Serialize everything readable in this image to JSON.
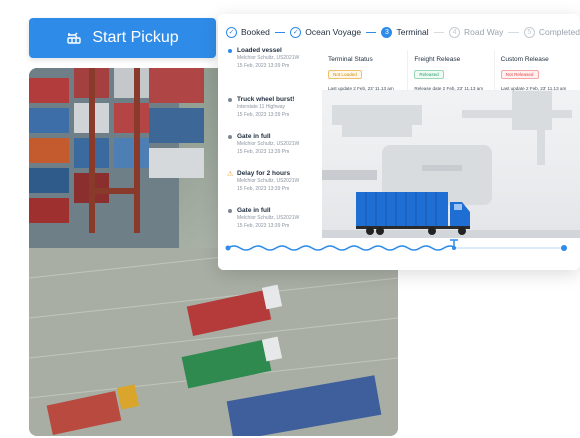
{
  "pickup_button": {
    "label": "Start Pickup",
    "icon": "truck-arrow-icon"
  },
  "tracker": {
    "steps": [
      {
        "label": "Booked",
        "state": "done",
        "mark": "✓"
      },
      {
        "label": "Ocean Voyage",
        "state": "done",
        "mark": "✓"
      },
      {
        "label": "Terminal",
        "state": "current",
        "mark": "3"
      },
      {
        "label": "Road Way",
        "state": "todo",
        "mark": "4"
      },
      {
        "label": "Completed",
        "state": "todo",
        "mark": "5"
      }
    ],
    "events": [
      {
        "title": "Loaded vessel",
        "place": "Melchior Schultz, US2021W",
        "time": "15 Feb, 2023 13:39 Pm",
        "kind": "blue"
      },
      {
        "title": "Truck wheel burst!",
        "place": "Interstate 11 Highway",
        "time": "15 Feb, 2023 13:39 Pm",
        "kind": "grey"
      },
      {
        "title": "Gate in full",
        "place": "Melchior Schultz, US2021W",
        "time": "15 Feb, 2023 13:39 Pm",
        "kind": "grey"
      },
      {
        "title": "Delay for 2 hours",
        "place": "Melchior Schultz, US2021W",
        "time": "15 Feb, 2023 13:39 Pm",
        "kind": "warn"
      },
      {
        "title": "Gate in full",
        "place": "Melchior Schultz, US2021W",
        "time": "15 Feb, 2023 13:39 Pm",
        "kind": "grey"
      }
    ],
    "statuses": [
      {
        "heading": "Terminal Status",
        "badge": "Not Loaded",
        "tone": "amber",
        "update": "Last update 2 Feb, 23' 11.13 am"
      },
      {
        "heading": "Freight Release",
        "badge": "Released",
        "tone": "green",
        "update": "Release date 2 Feb, 23' 11.13 am"
      },
      {
        "heading": "Custom Release",
        "badge": "Not Released",
        "tone": "red",
        "update": "Last update 2 Feb, 23' 11.13 am"
      }
    ]
  },
  "colors": {
    "accent": "#2f8be8",
    "truck_blue": "#1f6ed4"
  }
}
